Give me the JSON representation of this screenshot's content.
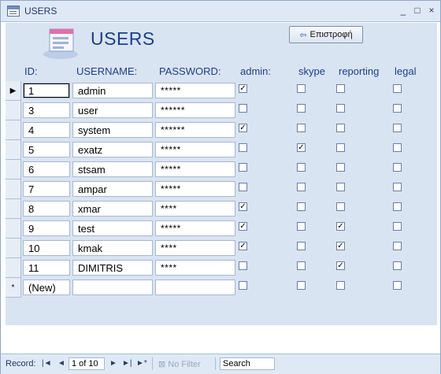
{
  "window": {
    "title": "USERS",
    "controls": [
      "_",
      "□",
      "×"
    ]
  },
  "header": {
    "title": "USERS",
    "back_button": "Επιστροφή",
    "back_icon": "back-arrow-icon"
  },
  "columns": [
    "ID:",
    "USERNAME:",
    "PASSWORD:",
    "admin:",
    "skype",
    "reporting",
    "legal"
  ],
  "rows": [
    {
      "id": "1",
      "username": "admin",
      "password": "*****",
      "admin": true,
      "skype": false,
      "reporting": false,
      "legal": false,
      "current": true
    },
    {
      "id": "3",
      "username": "user",
      "password": "******",
      "admin": false,
      "skype": false,
      "reporting": false,
      "legal": false
    },
    {
      "id": "4",
      "username": "system",
      "password": "******",
      "admin": true,
      "skype": false,
      "reporting": false,
      "legal": false
    },
    {
      "id": "5",
      "username": "exatz",
      "password": "*****",
      "admin": false,
      "skype": true,
      "reporting": false,
      "legal": false
    },
    {
      "id": "6",
      "username": "stsam",
      "password": "*****",
      "admin": false,
      "skype": false,
      "reporting": false,
      "legal": false
    },
    {
      "id": "7",
      "username": "ampar",
      "password": "*****",
      "admin": false,
      "skype": false,
      "reporting": false,
      "legal": false
    },
    {
      "id": "8",
      "username": "xmar",
      "password": "****",
      "admin": true,
      "skype": false,
      "reporting": false,
      "legal": false
    },
    {
      "id": "9",
      "username": "test",
      "password": "*****",
      "admin": true,
      "skype": false,
      "reporting": true,
      "legal": false
    },
    {
      "id": "10",
      "username": "kmak",
      "password": "****",
      "admin": true,
      "skype": false,
      "reporting": true,
      "legal": false
    },
    {
      "id": "11",
      "username": "DIMITRIS",
      "password": "****",
      "admin": false,
      "skype": false,
      "reporting": true,
      "legal": false
    }
  ],
  "new_row": {
    "id": "(New)",
    "marker": "*"
  },
  "navigation": {
    "label": "Record:",
    "first": "|◄",
    "prev": "◄",
    "position": "1 of 10",
    "next": "►",
    "last": "►|",
    "new": "►*",
    "filter": "No Filter",
    "search": "Search"
  },
  "colors": {
    "band": "#d9e4f2",
    "title": "#1b3f8b",
    "chrome": "#dfe9f6"
  }
}
